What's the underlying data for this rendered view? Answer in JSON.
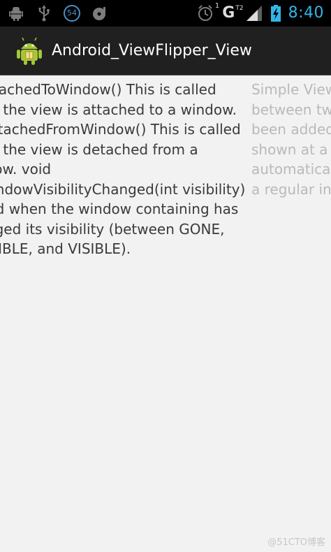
{
  "status_bar": {
    "network_type": "G",
    "network_badge": "T2",
    "notification_count": "54",
    "sim_sub": "1",
    "time": "8:40",
    "accent_color": "#33b5e5",
    "icons": [
      "android-debug-icon",
      "usb-icon",
      "notification-badge-icon",
      "disk-sync-icon",
      "alarm-icon",
      "signal-icon",
      "battery-charging-icon"
    ]
  },
  "action_bar": {
    "title": "Android_ViewFlipper_View",
    "app_icon": "android-robot-icon"
  },
  "flipper": {
    "current_text": "onAttachedToWindow() This is called when the view is attached to a window. onDetachedFromWindow() This is called when the view is detached from a window. void onWindowVisibilityChanged(int visibility) Called when the window containing has changed its visibility (between GONE, INVISIBLE, and VISIBLE).",
    "next_text": "Simple ViewAnimator that will animate between two or more views that have been added to it. Only one child is shown at a time. If requested, can automatically flip between each child at a regular interval."
  },
  "watermark": "@51CTO博客"
}
